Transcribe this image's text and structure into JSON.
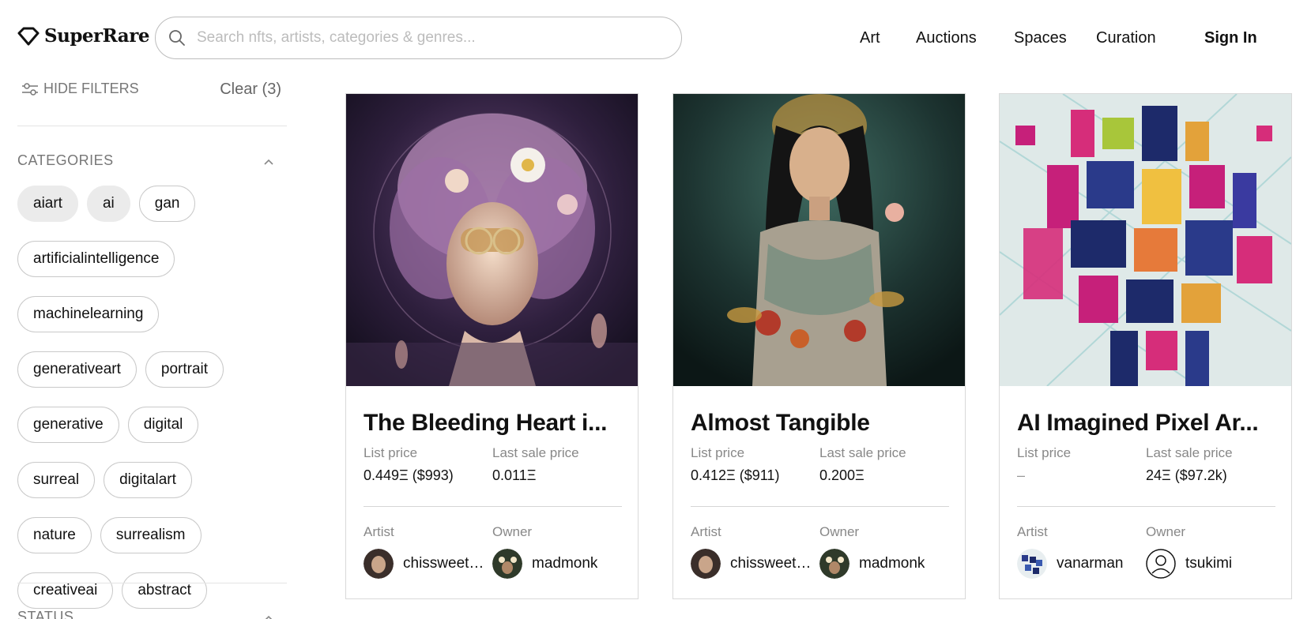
{
  "brand": {
    "name": "SuperRare"
  },
  "search": {
    "placeholder": "Search nfts, artists, categories & genres..."
  },
  "nav": {
    "art": "Art",
    "auctions": "Auctions",
    "spaces": "Spaces",
    "curation": "Curation",
    "sign_in": "Sign In"
  },
  "sidebar": {
    "hide_filters": "HIDE FILTERS",
    "clear": "Clear (3)",
    "categories_title": "CATEGORIES",
    "status_title": "STATUS",
    "chips": [
      {
        "label": "aiart",
        "selected": true
      },
      {
        "label": "ai",
        "selected": true
      },
      {
        "label": "gan",
        "selected": false
      },
      {
        "label": "artificialintelligence",
        "selected": false
      },
      {
        "label": "machinelearning",
        "selected": false
      },
      {
        "label": "generativeart",
        "selected": false
      },
      {
        "label": "portrait",
        "selected": false
      },
      {
        "label": "generative",
        "selected": false
      },
      {
        "label": "digital",
        "selected": false
      },
      {
        "label": "surreal",
        "selected": false
      },
      {
        "label": "digitalart",
        "selected": false
      },
      {
        "label": "nature",
        "selected": false
      },
      {
        "label": "surrealism",
        "selected": false
      },
      {
        "label": "creativeai",
        "selected": false
      },
      {
        "label": "abstract",
        "selected": false
      }
    ]
  },
  "cards": [
    {
      "title": "The Bleeding Heart i...",
      "list_price_label": "List price",
      "list_price": "0.449Ξ ($993)",
      "last_sale_label": "Last sale price",
      "last_sale": "0.011Ξ",
      "artist_label": "Artist",
      "artist": "chissweeta...",
      "owner_label": "Owner",
      "owner": "madmonk"
    },
    {
      "title": "Almost Tangible",
      "list_price_label": "List price",
      "list_price": "0.412Ξ ($911)",
      "last_sale_label": "Last sale price",
      "last_sale": "0.200Ξ",
      "artist_label": "Artist",
      "artist": "chissweeta...",
      "owner_label": "Owner",
      "owner": "madmonk"
    },
    {
      "title": "AI Imagined Pixel Ar...",
      "list_price_label": "List price",
      "list_price": "–",
      "last_sale_label": "Last sale price",
      "last_sale": "24Ξ ($97.2k)",
      "artist_label": "Artist",
      "artist": "vanarman",
      "owner_label": "Owner",
      "owner": "tsukimi"
    }
  ],
  "colors": {
    "text": "#111111",
    "muted": "#888888",
    "border": "#d9d9d9",
    "chip_selected": "#ebebeb"
  }
}
